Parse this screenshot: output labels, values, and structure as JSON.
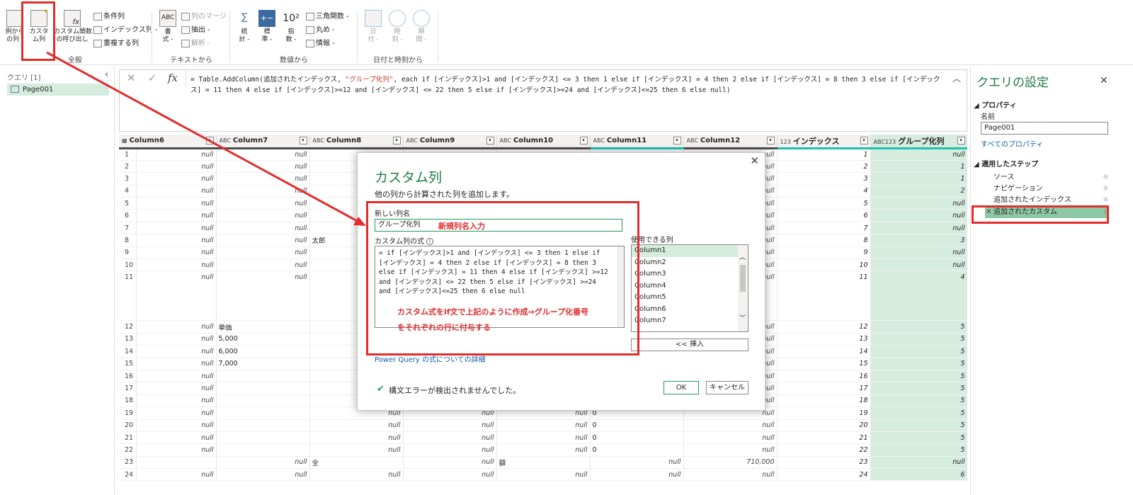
{
  "ribbon": {
    "general": {
      "label": "全般",
      "from_example": "例から\nの列 -",
      "custom_column": "カスタ\nム列",
      "invoke_custom_function": "カスタム関数\nの呼び出し",
      "conditional_column": "条件列",
      "index_column": "インデックス列 -",
      "duplicate_column": "重複する列"
    },
    "text": {
      "label": "テキストから",
      "format": "書\n式 -",
      "merge_columns": "列のマージ",
      "extract": "抽出 -",
      "parse": "解析 -"
    },
    "number": {
      "label": "数値から",
      "statistics": "統\n計 -",
      "standard": "標\n準 -",
      "scientific": "指\n数 -",
      "scientific_glyph": "10²",
      "trigonometry": "三角関数 -",
      "rounding": "丸め -",
      "information": "情報 -"
    },
    "datetime": {
      "label": "日付と時刻から",
      "date": "日\n付 -",
      "time": "時\n刻 -",
      "duration": "期\n間 -"
    }
  },
  "queries": {
    "header": "クエリ [1]",
    "items": [
      "Page001"
    ]
  },
  "formula_bar": {
    "prefix": "= Table.AddColumn(追加されたインデックス, ",
    "column_name": "\"グループ化列\"",
    "expression": ", each if [インデックス]>1 and [インデックス] <= 3 then 1 else if [インデックス] = 4 then 2 else if [インデックス] = 8 then 3 else if [インデックス] = 11 then 4 else if [インデックス]>=12 and [インデックス] <= 22 then 5 else if [インデックス]>=24 and [インデックス]<=25 then 6 else null)"
  },
  "table": {
    "columns": [
      {
        "type": "",
        "name": "Column6"
      },
      {
        "type": "ABC",
        "name": "Column7"
      },
      {
        "type": "ABC",
        "name": "Column8"
      },
      {
        "type": "ABC",
        "name": "Column9"
      },
      {
        "type": "ABC",
        "name": "Column10"
      },
      {
        "type": "ABC",
        "name": "Column11"
      },
      {
        "type": "ABC",
        "name": "Column12"
      },
      {
        "type": "123",
        "name": "インデックス"
      },
      {
        "type": "ABC123",
        "name": "グループ化列"
      }
    ],
    "rows": [
      {
        "n": "1",
        "c6": "null",
        "c7": "null",
        "c8": "",
        "c9": "",
        "c10": "",
        "c11": "",
        "c12": "null",
        "idx": "1",
        "grp": "null"
      },
      {
        "n": "2",
        "c6": "null",
        "c7": "null",
        "c8": "",
        "c9": "",
        "c10": "",
        "c11": "",
        "c12": "null",
        "idx": "2",
        "grp": "1"
      },
      {
        "n": "3",
        "c6": "null",
        "c7": "null",
        "c8": "",
        "c9": "",
        "c10": "",
        "c11": "",
        "c12": "null",
        "idx": "3",
        "grp": "1"
      },
      {
        "n": "4",
        "c6": "null",
        "c7": "null",
        "c8": "",
        "c9": "",
        "c10": "",
        "c11": "",
        "c12": "null",
        "idx": "4",
        "grp": "2"
      },
      {
        "n": "5",
        "c6": "null",
        "c7": "null",
        "c8": "",
        "c9": "",
        "c10": "",
        "c11": "",
        "c12": "null",
        "idx": "5",
        "grp": "null"
      },
      {
        "n": "6",
        "c6": "null",
        "c7": "null",
        "c8": "",
        "c9": "",
        "c10": "",
        "c11": "",
        "c12": "null",
        "idx": "6",
        "grp": "null"
      },
      {
        "n": "7",
        "c6": "null",
        "c7": "null",
        "c8": "",
        "c9": "",
        "c10": "",
        "c11": "",
        "c12": "null",
        "idx": "7",
        "grp": "null"
      },
      {
        "n": "8",
        "c6": "null",
        "c7": "null",
        "c8": "太郎",
        "c9": "",
        "c10": "",
        "c11": "",
        "c12": "null",
        "idx": "8",
        "grp": "3"
      },
      {
        "n": "9",
        "c6": "null",
        "c7": "null",
        "c8": "",
        "c9": "",
        "c10": "",
        "c11": "",
        "c12": "null",
        "idx": "9",
        "grp": "null"
      },
      {
        "n": "10",
        "c6": "null",
        "c7": "null",
        "c8": "",
        "c9": "",
        "c10": "",
        "c11": "",
        "c12": "null",
        "idx": "10",
        "grp": "null"
      },
      {
        "n": "11",
        "c6": "null",
        "c7": "null",
        "c8": "",
        "c9": "",
        "c10": "",
        "c11": "",
        "c12": "null",
        "idx": "11",
        "grp": "4"
      },
      {
        "n": "12",
        "c6": "null",
        "c7": "単価",
        "c8": "",
        "c9": "",
        "c10": "",
        "c11": "",
        "c12": "null",
        "idx": "12",
        "grp": "5"
      },
      {
        "n": "13",
        "c6": "null",
        "c7": "5,000",
        "c8": "",
        "c9": "",
        "c10": "",
        "c11": "",
        "c12": "null",
        "idx": "13",
        "grp": "5"
      },
      {
        "n": "14",
        "c6": "null",
        "c7": "6,000",
        "c8": "",
        "c9": "",
        "c10": "",
        "c11": "",
        "c12": "null",
        "idx": "14",
        "grp": "5"
      },
      {
        "n": "15",
        "c6": "null",
        "c7": "7,000",
        "c8": "",
        "c9": "",
        "c10": "",
        "c11": "",
        "c12": "null",
        "idx": "15",
        "grp": "5"
      },
      {
        "n": "16",
        "c6": "null",
        "c7": "",
        "c8": "",
        "c9": "",
        "c10": "",
        "c11": "",
        "c12": "null",
        "idx": "16",
        "grp": "5"
      },
      {
        "n": "17",
        "c6": "null",
        "c7": "",
        "c8": "",
        "c9": "",
        "c10": "",
        "c11": "",
        "c12": "null",
        "idx": "17",
        "grp": "5"
      },
      {
        "n": "18",
        "c6": "null",
        "c7": "",
        "c8": "",
        "c9": "",
        "c10": "",
        "c11": "",
        "c12": "null",
        "idx": "18",
        "grp": "5"
      },
      {
        "n": "19",
        "c6": "null",
        "c7": "",
        "c8": "null",
        "c9": "null",
        "c10": "null",
        "c11": "0",
        "c12": "null",
        "idx": "19",
        "grp": "5"
      },
      {
        "n": "20",
        "c6": "null",
        "c7": "",
        "c8": "null",
        "c9": "null",
        "c10": "null",
        "c11": "0",
        "c12": "null",
        "idx": "20",
        "grp": "5"
      },
      {
        "n": "21",
        "c6": "null",
        "c7": "",
        "c8": "null",
        "c9": "null",
        "c10": "null",
        "c11": "0",
        "c12": "null",
        "idx": "21",
        "grp": "5"
      },
      {
        "n": "22",
        "c6": "null",
        "c7": "",
        "c8": "null",
        "c9": "null",
        "c10": "null",
        "c11": "0",
        "c12": "null",
        "idx": "22",
        "grp": "5"
      },
      {
        "n": "23",
        "c6": "",
        "c7": "null",
        "c8": "全",
        "c9": "null",
        "c10": "額",
        "c11": "null",
        "c12": "710,000",
        "idx": "23",
        "grp": "null"
      },
      {
        "n": "24",
        "c6": "null",
        "c7": "null",
        "c8": "null",
        "c9": "null",
        "c10": "null",
        "c11": "null",
        "c12": "null",
        "idx": "24",
        "grp": "6"
      }
    ]
  },
  "settings": {
    "title": "クエリの設定",
    "properties_header": "プロパティ",
    "name_label": "名前",
    "name_value": "Page001",
    "all_properties": "すべてのプロパティ",
    "steps_header": "適用したステップ",
    "steps": [
      "ソース",
      "ナビゲーション",
      "追加されたインデックス",
      "追加されたカスタム"
    ]
  },
  "dialog": {
    "title": "カスタム列",
    "subtitle": "他の列から計算された列を追加します。",
    "new_column_label": "新しい列名",
    "new_column_value": "グループ化列",
    "formula_label": "カスタム列の式",
    "formula_info": "i",
    "formula_text": "= if [インデックス]>1 and [インデックス] <= 3 then 1 else if [インデックス] = 4 then 2 else if [インデックス] = 8 then 3 else if [インデックス] = 11 then 4 else if [インデックス] >=12 and [インデックス] <= 22 then 5 else if [インデックス] >=24 and [インデックス]<=25 then 6 else null",
    "available_label": "使用できる列",
    "available_columns": [
      "Column1",
      "Column2",
      "Column3",
      "Column4",
      "Column5",
      "Column6",
      "Column7"
    ],
    "insert_button": "<< 挿入",
    "learn_link": "Power Query の式についての詳細",
    "status": "構文エラーが検出されませんでした。",
    "ok": "OK",
    "cancel": "キャンセル"
  },
  "annotations": {
    "new_name_note": "新規列名入力",
    "formula_note_1": "カスタム式をif文で上記のように作成⇒グループ化番号",
    "formula_note_2": "をそれぞれの行に付与する"
  },
  "colors": {
    "accent_green": "#1f7a44",
    "selection_green": "#d6ecdf",
    "annotation_red": "#e22d2d"
  }
}
